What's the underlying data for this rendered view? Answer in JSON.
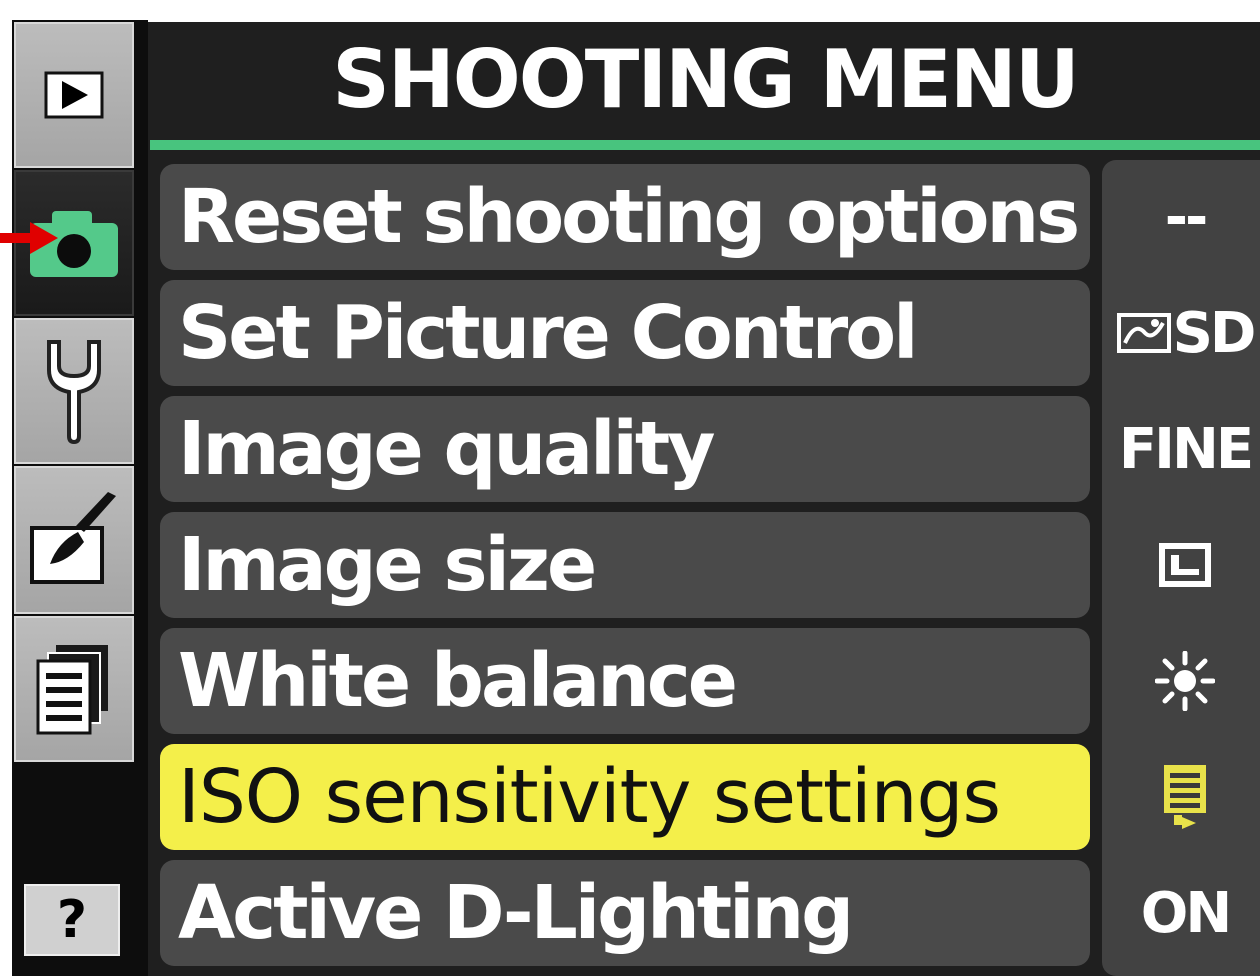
{
  "header": {
    "title": "SHOOTING MENU"
  },
  "tabs": [
    {
      "icon": "playback-icon",
      "active": false
    },
    {
      "icon": "camera-icon",
      "active": true
    },
    {
      "icon": "wrench-icon",
      "active": false
    },
    {
      "icon": "retouch-brush-icon",
      "active": false
    },
    {
      "icon": "my-menu-icon",
      "active": false
    }
  ],
  "help": {
    "label": "?"
  },
  "menu": {
    "items": [
      {
        "label": "Reset shooting options",
        "value": "--",
        "selected": false
      },
      {
        "label": "Set Picture Control",
        "value": "SD",
        "value_icon": "picture-control-icon",
        "selected": false
      },
      {
        "label": "Image quality",
        "value": "FINE",
        "selected": false
      },
      {
        "label": "Image size",
        "value_icon": "image-size-large-icon",
        "selected": false
      },
      {
        "label": "White balance",
        "value_icon": "sun-icon",
        "selected": false
      },
      {
        "label": "ISO sensitivity settings",
        "value_icon": "iso-list-icon",
        "selected": true
      },
      {
        "label": "Active D-Lighting",
        "value": "ON",
        "selected": false
      }
    ]
  },
  "colors": {
    "accent_green": "#48c47e",
    "selection_yellow": "#f4ef4a",
    "row_bg": "#4a4a4a",
    "pointer_red": "#e00000"
  }
}
